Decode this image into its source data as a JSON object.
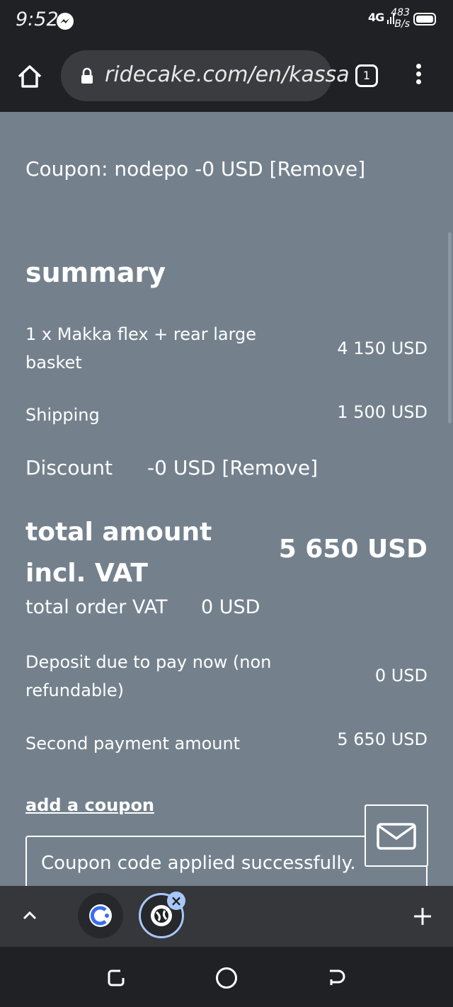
{
  "status_bar": {
    "time": "9:52",
    "signal": "4G",
    "net_speed_value": "483",
    "net_speed_unit": "B/s",
    "icons": [
      "messenger-icon",
      "signal-icon",
      "battery-icon"
    ]
  },
  "browser": {
    "url": "ridecake.com/en/kassa",
    "tab_count": "1",
    "icons": [
      "home-icon",
      "lock-icon",
      "tabs-icon",
      "menu-icon"
    ]
  },
  "page": {
    "coupon_line": "Coupon: nodepo -0 USD [Remove]",
    "summary_title": "summary",
    "item_label": "1 x Makka flex + rear large basket",
    "item_value": "4 150 USD",
    "shipping_label": "Shipping",
    "shipping_value": "1 500 USD",
    "discount_label": "Discount",
    "discount_value": "-0 USD [Remove]",
    "total_label": "total amount incl. VAT",
    "total_value": "5 650 USD",
    "vat_label": "total order VAT",
    "vat_value": "0 USD",
    "deposit_label": "Deposit due to pay now (non refundable)",
    "deposit_value": "0 USD",
    "second_label": "Second payment amount",
    "second_value": "5 650 USD",
    "add_coupon": "add a coupon",
    "coupon_message": "Coupon code applied successfully."
  },
  "colors": {
    "page_background": "#74818d",
    "chrome_background": "#1f2124",
    "tab_strip_background": "#35373b",
    "active_tab_accent": "#a8c7fa"
  }
}
